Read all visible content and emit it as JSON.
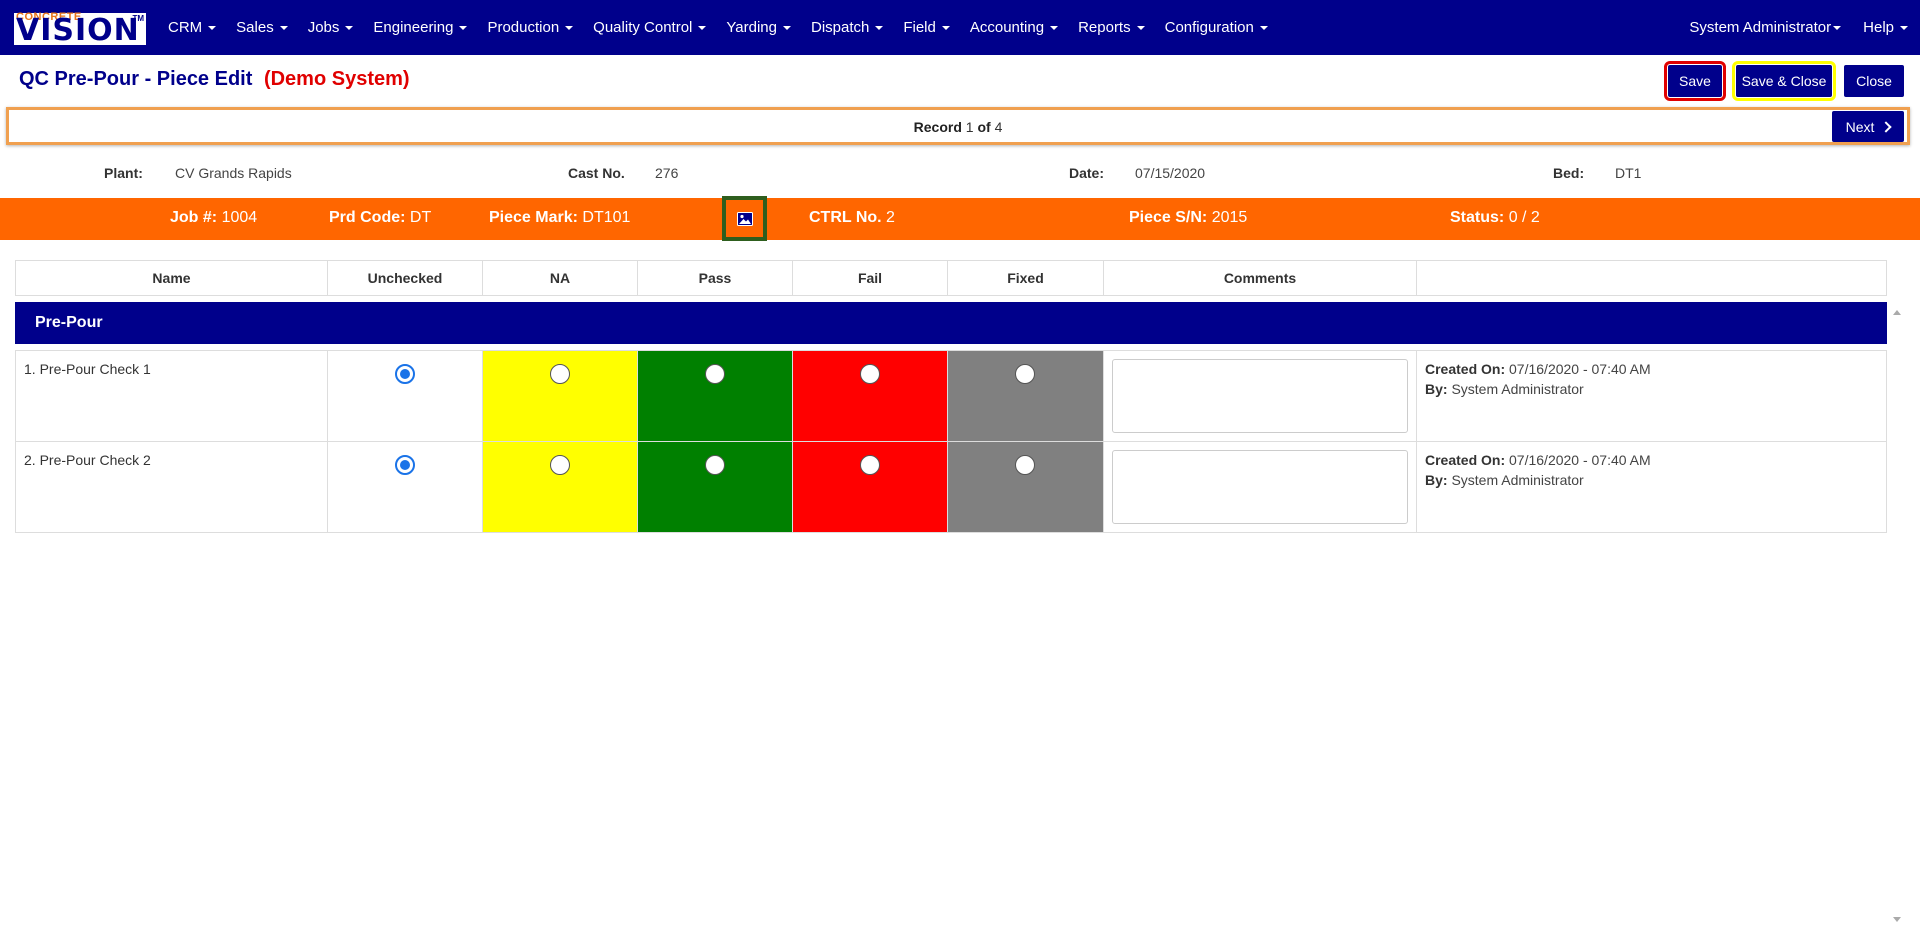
{
  "app": {
    "logo_small": "CONCRETE",
    "logo_big": "VISION",
    "logo_tm": "TM"
  },
  "nav": {
    "items": [
      "CRM",
      "Sales",
      "Jobs",
      "Engineering",
      "Production",
      "Quality Control",
      "Yarding",
      "Dispatch",
      "Field",
      "Accounting",
      "Reports",
      "Configuration"
    ],
    "user": "System Administrator",
    "help": "Help"
  },
  "page": {
    "title": "QC Pre-Pour - Piece Edit",
    "demo": "(Demo System)"
  },
  "toolbar": {
    "save_label": "Save",
    "save_close_label": "Save & Close",
    "close_label": "Close"
  },
  "record": {
    "label": "Record",
    "current": "1",
    "of_label": "of",
    "total": "4",
    "next_label": "Next"
  },
  "info": {
    "plant_label": "Plant:",
    "plant_value": "CV Grands Rapids",
    "cast_label": "Cast No.",
    "cast_value": "276",
    "date_label": "Date:",
    "date_value": "07/15/2020",
    "bed_label": "Bed:",
    "bed_value": "DT1"
  },
  "piece": {
    "job_label": "Job #:",
    "job_value": "1004",
    "prd_label": "Prd Code:",
    "prd_value": "DT",
    "mark_label": "Piece Mark:",
    "mark_value": "DT101",
    "ctrl_label": "CTRL No.",
    "ctrl_value": "2",
    "sn_label": "Piece S/N:",
    "sn_value": "2015",
    "status_label": "Status:",
    "status_value": "0 / 2",
    "image_icon": "image-icon"
  },
  "table": {
    "headers": [
      "Name",
      "Unchecked",
      "NA",
      "Pass",
      "Fail",
      "Fixed",
      "Comments",
      ""
    ],
    "section": "Pre-Pour",
    "colors": {
      "na": "#ffff00",
      "pass": "#008000",
      "fail": "#ff0000",
      "fixed": "#808080"
    },
    "rows": [
      {
        "name": "1. Pre-Pour Check 1",
        "selected": "Unchecked",
        "comment": "",
        "created_label": "Created On:",
        "created_value": "07/16/2020 - 07:40 AM",
        "by_label": "By:",
        "by_value": "System Administrator"
      },
      {
        "name": "2. Pre-Pour Check 2",
        "selected": "Unchecked",
        "comment": "",
        "created_label": "Created On:",
        "created_value": "07/16/2020 - 07:40 AM",
        "by_label": "By:",
        "by_value": "System Administrator"
      }
    ]
  }
}
